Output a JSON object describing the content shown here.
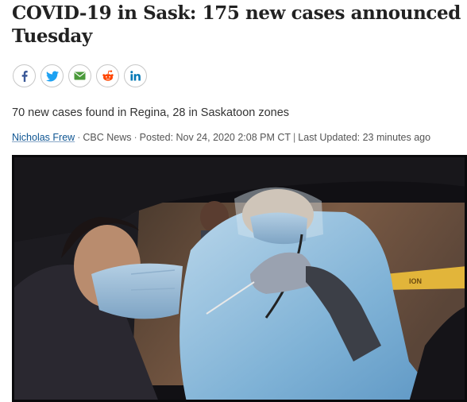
{
  "article": {
    "headline": "COVID-19 in Sask: 175 new cases announced Tuesday",
    "subtitle": "70 new cases found in Regina, 28 in Saskatoon zones",
    "author": "Nicholas Frew",
    "source": "CBC News",
    "posted_label": "Posted: Nov 24, 2020 2:08 PM CT",
    "divider": "|",
    "updated_label": "Last Updated: 23 minutes ago",
    "byline_separator": "·"
  },
  "share": {
    "icons": [
      "facebook-icon",
      "twitter-icon",
      "email-icon",
      "reddit-icon",
      "linkedin-icon"
    ],
    "colors": {
      "facebook": "#3b5998",
      "twitter": "#1da1f2",
      "email": "#4a9a3a",
      "reddit": "#ff4500",
      "linkedin": "#0077b5"
    }
  },
  "photo": {
    "subject": "drive-through COVID-19 swab test"
  }
}
